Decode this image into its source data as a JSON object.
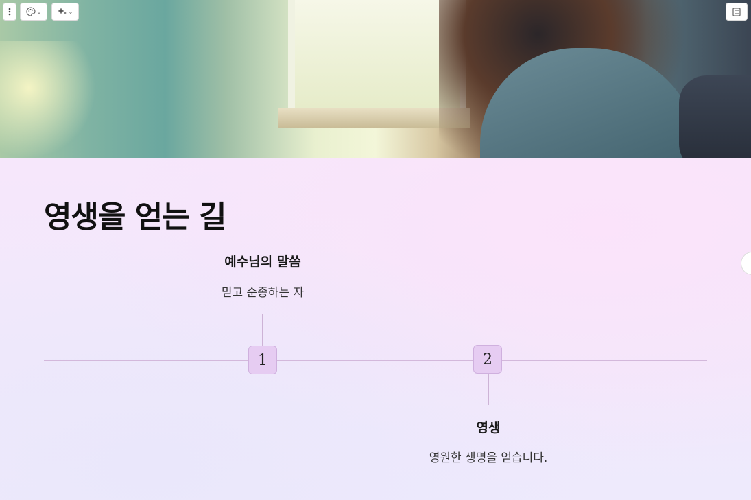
{
  "title": "영생을 얻는 길",
  "timeline": [
    {
      "number": "1",
      "title": "예수님의 말씀",
      "description": "믿고 순종하는 자"
    },
    {
      "number": "2",
      "title": "영생",
      "description": "영원한 생명을 얻습니다."
    }
  ],
  "toolbar": {
    "more_icon": "vertical-ellipsis-icon",
    "theme_icon": "palette-icon",
    "ai_icon": "sparkle-icon",
    "notes_icon": "notes-icon"
  },
  "colors": {
    "node_fill": "#e6ccf2",
    "line": "#d3b8db",
    "background": "#f3e8fb"
  }
}
